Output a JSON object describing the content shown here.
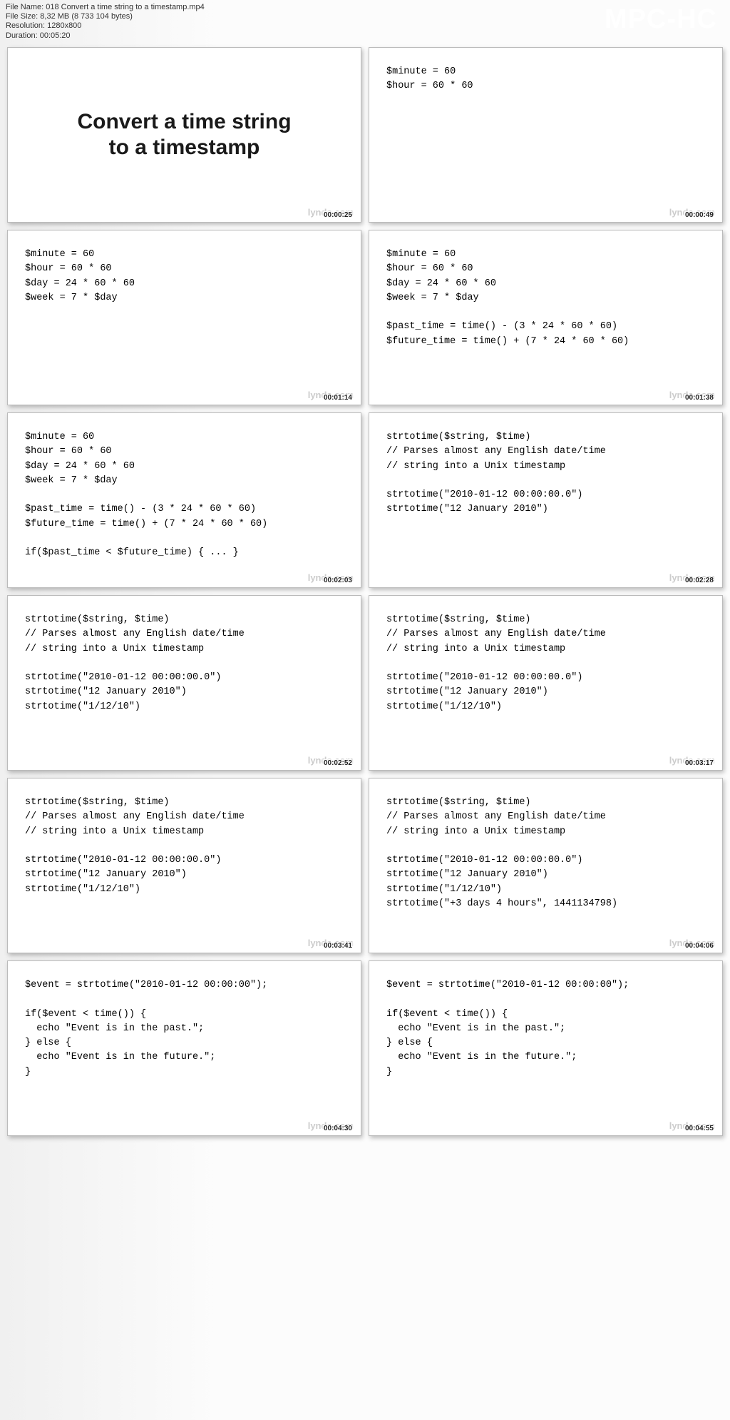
{
  "header": {
    "app": "MPC-HC",
    "info": {
      "filename_label": "File Name: ",
      "filename": "018 Convert a time string to a timestamp.mp4",
      "filesize_label": "File Size: ",
      "filesize": "8,32 MB (8 733 104 bytes)",
      "resolution_label": "Resolution: ",
      "resolution": "1280x800",
      "duration_label": "Duration: ",
      "duration": "00:05:20"
    }
  },
  "watermark": "lynda.com",
  "frames": [
    {
      "type": "title",
      "title": "Convert a time string\nto a timestamp",
      "ts": "00:00:25"
    },
    {
      "type": "code",
      "code": "$minute = 60\n$hour = 60 * 60",
      "ts": "00:00:49"
    },
    {
      "type": "code",
      "code": "$minute = 60\n$hour = 60 * 60\n$day = 24 * 60 * 60\n$week = 7 * $day",
      "ts": "00:01:14"
    },
    {
      "type": "code",
      "code": "$minute = 60\n$hour = 60 * 60\n$day = 24 * 60 * 60\n$week = 7 * $day\n\n$past_time = time() - (3 * 24 * 60 * 60)\n$future_time = time() + (7 * 24 * 60 * 60)",
      "ts": "00:01:38"
    },
    {
      "type": "code",
      "code": "$minute = 60\n$hour = 60 * 60\n$day = 24 * 60 * 60\n$week = 7 * $day\n\n$past_time = time() - (3 * 24 * 60 * 60)\n$future_time = time() + (7 * 24 * 60 * 60)\n\nif($past_time < $future_time) { ... }",
      "ts": "00:02:03"
    },
    {
      "type": "code",
      "code": "strtotime($string, $time)\n// Parses almost any English date/time\n// string into a Unix timestamp\n\nstrtotime(\"2010-01-12 00:00:00.0\")\nstrtotime(\"12 January 2010\")",
      "ts": "00:02:28"
    },
    {
      "type": "code",
      "code": "strtotime($string, $time)\n// Parses almost any English date/time\n// string into a Unix timestamp\n\nstrtotime(\"2010-01-12 00:00:00.0\")\nstrtotime(\"12 January 2010\")\nstrtotime(\"1/12/10\")",
      "ts": "00:02:52"
    },
    {
      "type": "code",
      "code": "strtotime($string, $time)\n// Parses almost any English date/time\n// string into a Unix timestamp\n\nstrtotime(\"2010-01-12 00:00:00.0\")\nstrtotime(\"12 January 2010\")\nstrtotime(\"1/12/10\")",
      "ts": "00:03:17"
    },
    {
      "type": "code",
      "code": "strtotime($string, $time)\n// Parses almost any English date/time\n// string into a Unix timestamp\n\nstrtotime(\"2010-01-12 00:00:00.0\")\nstrtotime(\"12 January 2010\")\nstrtotime(\"1/12/10\")",
      "ts": "00:03:41"
    },
    {
      "type": "code",
      "code": "strtotime($string, $time)\n// Parses almost any English date/time\n// string into a Unix timestamp\n\nstrtotime(\"2010-01-12 00:00:00.0\")\nstrtotime(\"12 January 2010\")\nstrtotime(\"1/12/10\")\nstrtotime(\"+3 days 4 hours\", 1441134798)",
      "ts": "00:04:06"
    },
    {
      "type": "code",
      "code": "$event = strtotime(\"2010-01-12 00:00:00\");\n\nif($event < time()) {\n  echo \"Event is in the past.\";\n} else {\n  echo \"Event is in the future.\";\n}",
      "ts": "00:04:30"
    },
    {
      "type": "code",
      "code": "$event = strtotime(\"2010-01-12 00:00:00\");\n\nif($event < time()) {\n  echo \"Event is in the past.\";\n} else {\n  echo \"Event is in the future.\";\n}",
      "ts": "00:04:55"
    }
  ]
}
